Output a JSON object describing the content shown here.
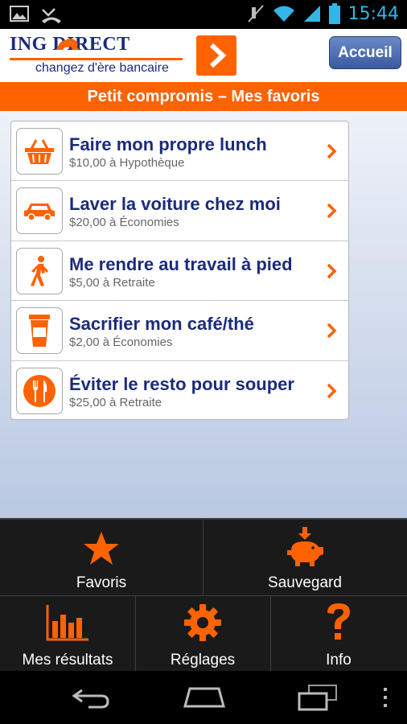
{
  "status_bar": {
    "time": "15:44",
    "icons": [
      "picture-icon",
      "missed-call-icon",
      "mute-icon",
      "wifi-icon",
      "signal-icon",
      "battery-icon"
    ]
  },
  "header": {
    "brand_name": "ING DIRECT",
    "tagline": "changez d'ère bancaire",
    "accueil_label": "Accueil",
    "brand_color": "#ff6200",
    "navy_color": "#1b2b7a"
  },
  "title_bar": {
    "title": "Petit compromis – Mes favoris"
  },
  "favorites": [
    {
      "title": "Faire mon propre lunch",
      "subtitle": "$10,00 à Hypothèque",
      "icon": "basket-icon"
    },
    {
      "title": "Laver la voiture chez moi",
      "subtitle": "$20,00 à Économies",
      "icon": "car-icon"
    },
    {
      "title": "Me rendre au travail à pied",
      "subtitle": "$5,00 à Retraite",
      "icon": "walking-icon"
    },
    {
      "title": "Sacrifier mon café/thé",
      "subtitle": "$2,00 à Économies",
      "icon": "coffee-cup-icon"
    },
    {
      "title": "Éviter le resto pour souper",
      "subtitle": "$25,00 à Retraite",
      "icon": "fork-knife-icon"
    }
  ],
  "bottom_menu": {
    "favoris": "Favoris",
    "sauvegard": "Sauvegard",
    "resultats": "Mes résultats",
    "reglages": "Réglages",
    "info": "Info"
  },
  "nav_bar": {
    "icons": [
      "back-icon",
      "home-icon",
      "recent-apps-icon",
      "overflow-menu-icon"
    ]
  }
}
